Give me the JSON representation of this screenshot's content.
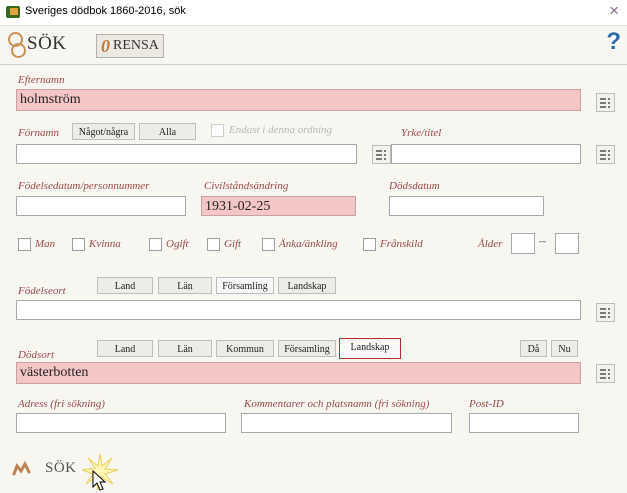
{
  "window": {
    "title": "Sveriges dödbok 1860-2016, sök",
    "close": "×"
  },
  "toolbar": {
    "search_label": "SÖK",
    "clear_label": "RENSA",
    "clear_icon": "0",
    "help": "?"
  },
  "efternamn": {
    "label": "Efternamn",
    "value": "holmström"
  },
  "fornamn": {
    "label": "Förnamn",
    "value": "",
    "btn_some": "Något/några",
    "btn_all": "Alla",
    "only_order": "Endast i denna ordning"
  },
  "yrke": {
    "label": "Yrke/titel",
    "value": ""
  },
  "fodelsedatum": {
    "label": "Födelsedatum/personnummer",
    "value": ""
  },
  "civilstand": {
    "label": "Civilståndsändring",
    "value": "1931-02-25"
  },
  "dodsdatum": {
    "label": "Dödsdatum",
    "value": ""
  },
  "checks": {
    "man": "Man",
    "kvinna": "Kvinna",
    "ogift": "Ogift",
    "gift": "Gift",
    "anka": "Änka/änkling",
    "franskild": "Frånskild",
    "alder": "Ålder",
    "dash": "–"
  },
  "fodelseort": {
    "label": "Födelseort",
    "value": "",
    "buttons": [
      "Land",
      "Län",
      "Församling",
      "Landskap"
    ]
  },
  "dodsort": {
    "label": "Dödsort",
    "value": "västerbotten",
    "buttons": [
      "Land",
      "Län",
      "Kommun",
      "Församling",
      "Landskap"
    ],
    "btn_da": "Då",
    "btn_nu": "Nu"
  },
  "adress": {
    "label": "Adress (fri sökning)",
    "value": ""
  },
  "kommentarer": {
    "label": "Kommentarer och platsnamn (fri sökning)",
    "value": ""
  },
  "postid": {
    "label": "Post-ID",
    "value": ""
  },
  "bottom": {
    "search_label": "SÖK"
  },
  "colors": {
    "label": "#9c4a4a",
    "pink_field": "#f4c6c6",
    "help": "#2f6fa8",
    "selected_border": "#b03030"
  }
}
